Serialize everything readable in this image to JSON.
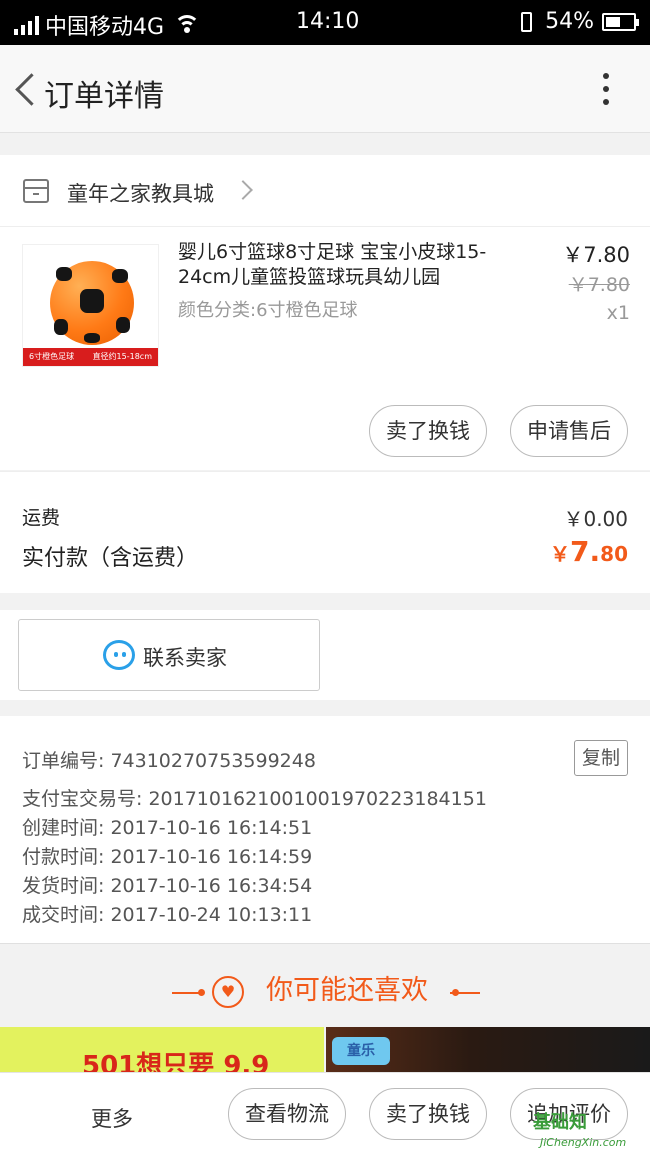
{
  "status_bar": {
    "carrier": "中国移动4G",
    "time": "14:10",
    "battery": "54%"
  },
  "nav": {
    "title": "订单详情"
  },
  "shop": {
    "name": "童年之家教具城"
  },
  "product": {
    "title": "婴儿6寸篮球8寸足球 宝宝小皮球15-24cm儿童篮投篮球玩具幼儿园",
    "spec": "颜色分类:6寸橙色足球",
    "price": "￥7.80",
    "original_price": "￥7.80",
    "quantity": "x1",
    "image_caption_left": "6寸橙色足球",
    "image_caption_right": "直径约15-18cm",
    "actions": {
      "sell_exchange": "卖了换钱",
      "after_sale": "申请售后"
    }
  },
  "fees": {
    "shipping_label": "运费",
    "shipping_value": "￥0.00",
    "total_label": "实付款（含运费）",
    "total_currency": "￥",
    "total_integer": "7.",
    "total_decimal": "80"
  },
  "contact": {
    "label": "联系卖家"
  },
  "order_info": {
    "copy_label": "复制",
    "lines": [
      "订单编号: 74310270753599248",
      "支付宝交易号: 2017101621001001970223184151",
      "创建时间: 2017-10-16 16:14:51",
      "付款时间: 2017-10-16 16:14:59",
      "发货时间: 2017-10-16 16:34:54",
      "成交时间: 2017-10-24 10:13:11"
    ]
  },
  "recommend": {
    "title": "你可能还喜欢",
    "banner1_text": "501想只要 9.9",
    "banner2_logo": "童乐"
  },
  "bottom_bar": {
    "more": "更多",
    "logistics": "查看物流",
    "sell_exchange": "卖了换钱",
    "add_review": "追加评价"
  },
  "watermark": {
    "text": "基础知",
    "url": "JiChengXin.com"
  },
  "colors": {
    "accent": "#f25a1a",
    "chat_blue": "#2aa0e8"
  }
}
